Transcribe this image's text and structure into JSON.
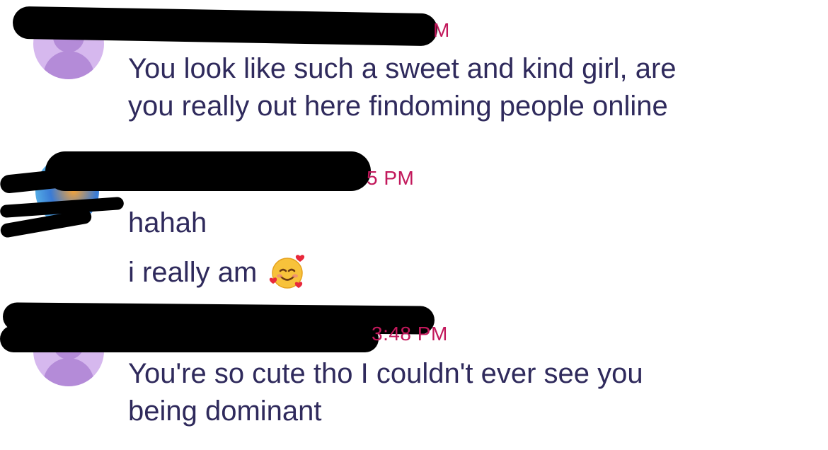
{
  "messages": [
    {
      "timestamp": "M",
      "lines": [
        "You look like such a sweet and kind girl, are",
        "you really out here findoming people online"
      ]
    },
    {
      "timestamp": "5 PM",
      "lines": [
        "hahah",
        "i really am"
      ],
      "emoji": "smiling-face-with-hearts-icon"
    },
    {
      "timestamp": "3:48 PM",
      "lines": [
        "You're so cute tho I couldn't ever see you",
        "being dominant"
      ]
    }
  ],
  "colors": {
    "text": "#2f2a5c",
    "timestamp": "#c2185b",
    "redaction": "#000000"
  }
}
